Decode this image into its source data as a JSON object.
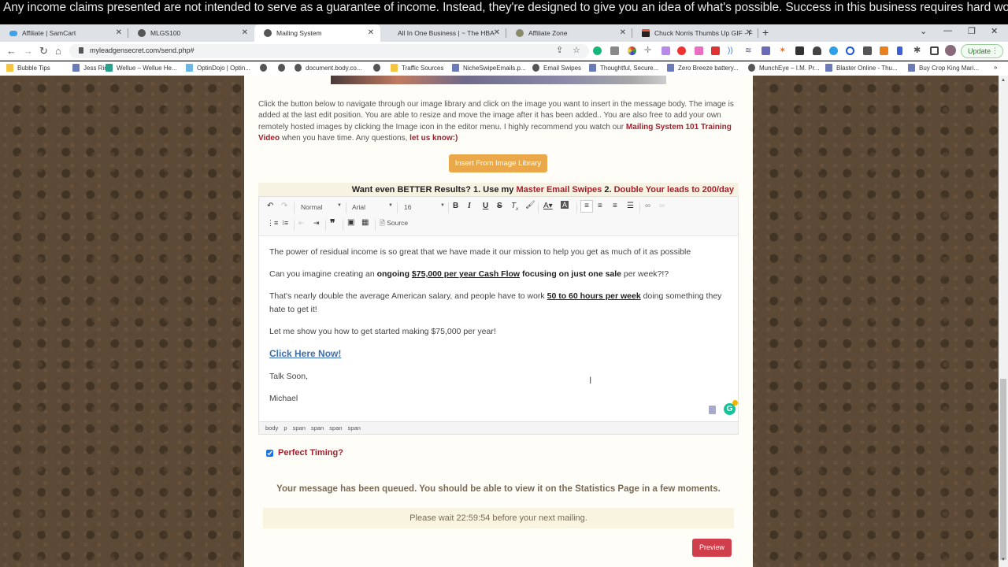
{
  "disclaimer": "Any income claims presented are not intended to serve as a guarantee of income. Instead, they're designed to give you an idea of what's possible. Success in this business requires hard work.",
  "browser": {
    "tabs": [
      {
        "label": "Affiliate | SamCart",
        "icon": "samcart-icon",
        "active": false
      },
      {
        "label": "MLGS100",
        "icon": "globe-icon",
        "active": false
      },
      {
        "label": "Mailing System",
        "icon": "globe-icon",
        "active": true
      },
      {
        "label": "All In One Business | ~ The HBA",
        "icon": "none",
        "active": false
      },
      {
        "label": "Affiliate Zone",
        "icon": "tree-icon",
        "active": false
      },
      {
        "label": "Chuck Norris Thumbs Up GIF - F",
        "icon": "giphy-icon",
        "active": false
      }
    ],
    "new_tab": "+",
    "url": "myleadgensecret.com/send.php#",
    "update_label": "Update",
    "bookmarks": [
      {
        "label": "Bubble Tips",
        "icon": "folder-icon"
      },
      {
        "label": "Jess Ring",
        "icon": "bookmark-icon"
      },
      {
        "label": "Wellue – Wellue He...",
        "icon": "heart-icon"
      },
      {
        "label": "OptinDojo | Optin...",
        "icon": "cloud-icon"
      },
      {
        "label": "",
        "icon": "globe-icon"
      },
      {
        "label": "",
        "icon": "globe-icon"
      },
      {
        "label": "document.body.co...",
        "icon": "globe-icon"
      },
      {
        "label": "",
        "icon": "globe-icon"
      },
      {
        "label": "Traffic Sources",
        "icon": "folder-icon"
      },
      {
        "label": "NicheSwipeEmails.p...",
        "icon": "bookmark-icon"
      },
      {
        "label": "Email Swipes",
        "icon": "globe-icon"
      },
      {
        "label": "Thoughtful, Secure...",
        "icon": "bookmark-icon"
      },
      {
        "label": "Zero Breeze battery...",
        "icon": "bookmark-icon"
      },
      {
        "label": "MunchEye – I.M. Pr...",
        "icon": "globe-icon"
      },
      {
        "label": "Blaster Online - Thu...",
        "icon": "bookmark-icon"
      },
      {
        "label": "Buy Crop King Mari...",
        "icon": "bookmark-icon"
      }
    ],
    "more_bookmarks": "»"
  },
  "page": {
    "intro_text_1": "Click the button below to navigate through our image library and click on the image you want to insert in the message body. The image is added at the last edit position. You are able to resize and move the image after it has been added.. You are also free to add your own remotely hosted images by clicking the Image icon in the editor menu. I highly recommend you watch our ",
    "intro_link_1": "Mailing System 101 Training Video",
    "intro_text_2": " when you have time. Any questions, ",
    "intro_link_2": "let us know:)",
    "insert_button": "Insert From Image Library",
    "promo_text_1": "Want even BETTER Results? 1. Use my ",
    "promo_link_1": "Master Email Swipes",
    "promo_text_2": " 2. ",
    "promo_link_2": "Double Your leads to 200/day",
    "editor": {
      "format_select": "Normal",
      "font_select": "Arial",
      "size_select": "16",
      "source_label": "Source",
      "content": {
        "p1": "The power of residual income is so great that we have made it our mission to help you get as much of it as possible",
        "p2_pre": "Can you imagine creating an ",
        "p2_b1": "ongoing ",
        "p2_u": "$75,000 per year Cash Flow",
        "p2_b2": " focusing on just one sale",
        "p2_post": " per week?!?",
        "p3_pre": "That's nearly double the average American salary, and people have to work ",
        "p3_u": "50 to 60 hours per week",
        "p3_post": " doing something they hate to get it!",
        "p4": "Let me show you how to get started making $75,000 per year!",
        "link": "Click Here Now!",
        "p5": "Talk Soon,",
        "p6": "Michael"
      },
      "path": "body p span span span span",
      "grammarly_count": "1"
    },
    "perfect_timing_label": "Perfect Timing?",
    "perfect_timing_checked": true,
    "queued_message": "Your message has been queued. You should be able to view it on the Statistics Page in a few moments.",
    "wait_message": "Please wait 22:59:54 before your next mailing.",
    "preview_button": "Preview"
  },
  "colors": {
    "accent_red": "#a81d2a",
    "insert_button": "#eba84b",
    "preview_button": "#d03d4b",
    "link_blue": "#3a6fb5"
  }
}
